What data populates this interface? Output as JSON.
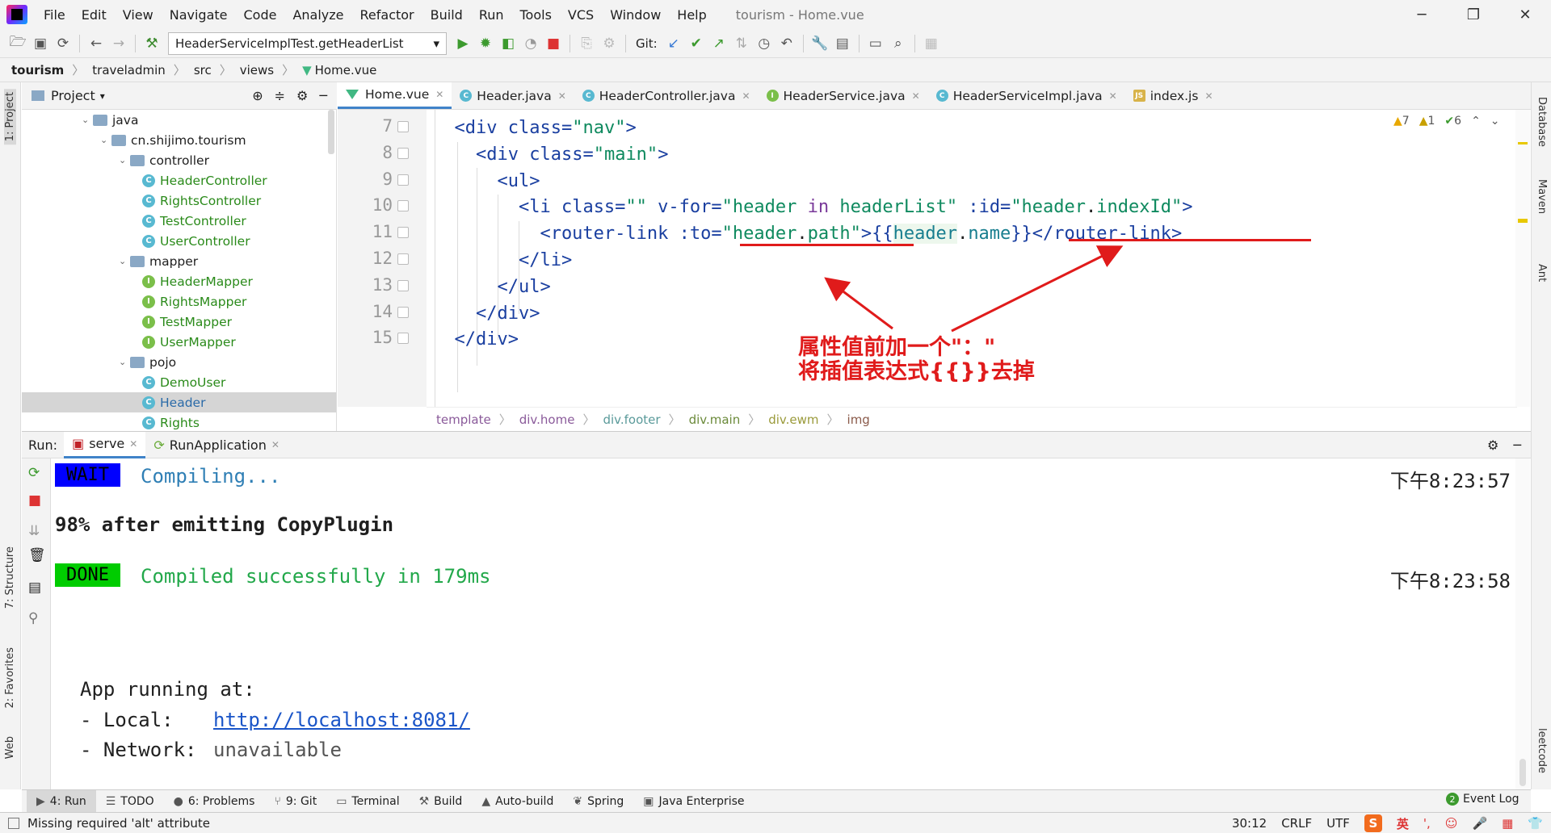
{
  "window": {
    "title": "tourism - Home.vue",
    "menu": [
      "File",
      "Edit",
      "View",
      "Navigate",
      "Code",
      "Analyze",
      "Refactor",
      "Build",
      "Run",
      "Tools",
      "VCS",
      "Window",
      "Help"
    ]
  },
  "toolbar": {
    "run_config": "HeaderServiceImplTest.getHeaderList",
    "git_label": "Git:"
  },
  "breadcrumb": [
    "tourism",
    "traveladmin",
    "src",
    "views",
    "Home.vue"
  ],
  "left_stripe": [
    "1: Project",
    "7: Structure",
    "2: Favorites",
    "Web"
  ],
  "right_stripe": [
    "Database",
    "Maven",
    "Ant",
    "leetcode"
  ],
  "project": {
    "title": "Project",
    "tree": [
      {
        "label": "java",
        "kind": "folder",
        "indent": 0
      },
      {
        "label": "cn.shijimo.tourism",
        "kind": "folder",
        "indent": 1
      },
      {
        "label": "controller",
        "kind": "folder",
        "indent": 2
      },
      {
        "label": "HeaderController",
        "kind": "c",
        "indent": 3
      },
      {
        "label": "RightsController",
        "kind": "c",
        "indent": 3
      },
      {
        "label": "TestController",
        "kind": "c",
        "indent": 3
      },
      {
        "label": "UserController",
        "kind": "c",
        "indent": 3
      },
      {
        "label": "mapper",
        "kind": "folder",
        "indent": 2
      },
      {
        "label": "HeaderMapper",
        "kind": "i",
        "indent": 3
      },
      {
        "label": "RightsMapper",
        "kind": "i",
        "indent": 3
      },
      {
        "label": "TestMapper",
        "kind": "i",
        "indent": 3
      },
      {
        "label": "UserMapper",
        "kind": "i",
        "indent": 3
      },
      {
        "label": "pojo",
        "kind": "folder",
        "indent": 2
      },
      {
        "label": "DemoUser",
        "kind": "c",
        "indent": 3
      },
      {
        "label": "Header",
        "kind": "c",
        "indent": 3,
        "selected": true
      },
      {
        "label": "Rights",
        "kind": "c",
        "indent": 3
      }
    ]
  },
  "editor_tabs": [
    {
      "label": "Home.vue",
      "icon": "vue-icon",
      "active": true
    },
    {
      "label": "Header.java",
      "icon": "class-icon"
    },
    {
      "label": "HeaderController.java",
      "icon": "class-icon"
    },
    {
      "label": "HeaderService.java",
      "icon": "interface-icon"
    },
    {
      "label": "HeaderServiceImpl.java",
      "icon": "class-icon"
    },
    {
      "label": "index.js",
      "icon": "js-icon"
    }
  ],
  "inspections": {
    "warnings": "7",
    "weak_warnings": "1",
    "ok": "6"
  },
  "code": {
    "line_numbers": [
      "7",
      "8",
      "9",
      "10",
      "11",
      "12",
      "13",
      "14",
      "15"
    ],
    "l7": {
      "indent": "  ",
      "open": "<div ",
      "attr": "class=",
      "val": "\"nav\"",
      "close": ">"
    },
    "l8": {
      "indent": "    ",
      "open": "<div ",
      "attr": "class=",
      "val": "\"main\"",
      "close": ">"
    },
    "l9": {
      "text": "      <ul>"
    },
    "l10": {
      "p1": "        <li ",
      "a1": "class=",
      "v1": "\"\"",
      "a2": " v-for=",
      "v2": "\"header ",
      "kw": "in",
      "v3": " headerList\"",
      "a3": " :id=",
      "v4": "\"header",
      "dot": ".",
      "v5": "indexId\"",
      "c": ">"
    },
    "l11": {
      "p1": "          <router-link ",
      "a1": ":to=",
      "v1": "\"header",
      "dot": ".",
      "v2": "path\"",
      "mid": ">{{",
      "var": "header",
      "dot2": ".",
      "name": "name",
      "end": "}}</router-link>"
    },
    "l12": {
      "text": "        </li>"
    },
    "l13": {
      "text": "      </ul>"
    },
    "l14": {
      "text": "    </div>"
    },
    "l15": {
      "text": "  </div>"
    }
  },
  "annotation": {
    "line1": "属性值前加一个\"：\"",
    "line2": "将插值表达式{{}}去掉",
    "color": "#e01b1b"
  },
  "editor_breadcrumb": [
    "template",
    "div.home",
    "div.footer",
    "div.main",
    "div.ewm",
    "img"
  ],
  "run": {
    "label": "Run:",
    "tabs": [
      "serve",
      "RunApplication"
    ],
    "console": {
      "wait_badge": "WAIT",
      "compiling": "Compiling...",
      "ts1": "下午8:23:57",
      "progress": "98% after emitting CopyPlugin",
      "done_badge": "DONE",
      "compiled": "Compiled successfully in 179ms",
      "ts2": "下午8:23:58",
      "app_running": "App running at:",
      "local_label": "- Local:   ",
      "local_url": "http://localhost:8081/",
      "network_label": "- Network: ",
      "network_val": "unavailable"
    }
  },
  "tool_tabs": [
    {
      "label": "4: Run",
      "icon": "play-icon",
      "active": true
    },
    {
      "label": "TODO",
      "icon": "list-icon"
    },
    {
      "label": "6: Problems",
      "icon": "problems-icon"
    },
    {
      "label": "9: Git",
      "icon": "git-icon"
    },
    {
      "label": "Terminal",
      "icon": "terminal-icon"
    },
    {
      "label": "Build",
      "icon": "build-icon"
    },
    {
      "label": "Auto-build",
      "icon": "warning-icon"
    },
    {
      "label": "Spring",
      "icon": "spring-icon"
    },
    {
      "label": "Java Enterprise",
      "icon": "enterprise-icon"
    }
  ],
  "event_log": {
    "count": "2",
    "label": "Event Log"
  },
  "status": {
    "message": "Missing required 'alt' attribute",
    "position": "30:12",
    "line_sep": "CRLF",
    "encoding": "UTF",
    "ime": "英"
  },
  "colors": {
    "accent": "#4083c9",
    "wait_bg": "#0000ff",
    "done_bg": "#00cc00",
    "success_text": "#22a84a"
  }
}
